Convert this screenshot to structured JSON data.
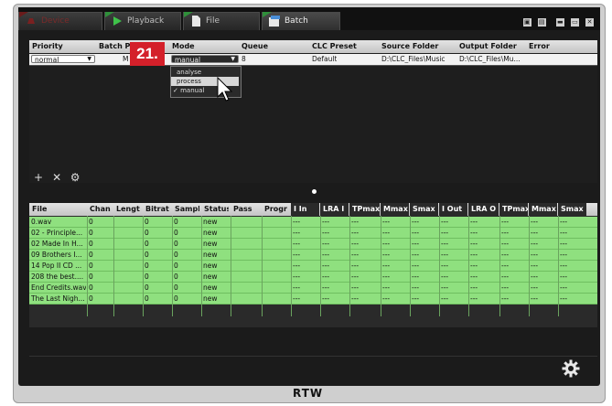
{
  "tabs": [
    {
      "label": "Device"
    },
    {
      "label": "Playback"
    },
    {
      "label": "File"
    },
    {
      "label": "Batch"
    }
  ],
  "window_buttons": [
    "▣",
    "▤",
    "▬",
    "▭",
    "✕"
  ],
  "callout": "21.",
  "batch_table": {
    "headers": [
      "Priority",
      "Batch Pr",
      "Mode",
      "Queue",
      "CLC Preset",
      "Source Folder",
      "Output Folder",
      "Error"
    ],
    "row": {
      "priority": "normal",
      "batch_pr": "M",
      "mode": "manual",
      "queue": "8",
      "clc_preset": "Default",
      "source_folder": "D:\\CLC_Files\\Music",
      "output_folder": "D:\\CLC_Files\\Mu..."
    },
    "mode_options": [
      "analyse",
      "process",
      "✓ manual"
    ]
  },
  "toolbar": {
    "add": "+",
    "remove": "✕",
    "settings": "⚙"
  },
  "file_table": {
    "headers": [
      "File",
      "Chan",
      "Lengt",
      "Bitrat",
      "Sampl",
      "Status",
      "Pass",
      "Progr",
      "I In",
      "LRA I",
      "TPmax",
      "Mmax",
      "Smax",
      "I Out",
      "LRA O",
      "TPmax",
      "Mmax",
      "Smax"
    ],
    "rows": [
      {
        "file": "0.wav",
        "chan": "0",
        "bitrate": "0",
        "sample": "0",
        "status": "new"
      },
      {
        "file": "02 - Principle...",
        "chan": "0",
        "bitrate": "0",
        "sample": "0",
        "status": "new"
      },
      {
        "file": "02 Made In H...",
        "chan": "0",
        "bitrate": "0",
        "sample": "0",
        "status": "new"
      },
      {
        "file": "09 Brothers I...",
        "chan": "0",
        "bitrate": "0",
        "sample": "0",
        "status": "new"
      },
      {
        "file": "14 Pop II CD ...",
        "chan": "0",
        "bitrate": "0",
        "sample": "0",
        "status": "new"
      },
      {
        "file": "208 the best....",
        "chan": "0",
        "bitrate": "0",
        "sample": "0",
        "status": "new"
      },
      {
        "file": "End Credits.wav",
        "chan": "0",
        "bitrate": "0",
        "sample": "0",
        "status": "new"
      },
      {
        "file": "The Last Nigh...",
        "chan": "0",
        "bitrate": "0",
        "sample": "0",
        "status": "new"
      }
    ],
    "placeholder": "---"
  },
  "brand": "RTW"
}
